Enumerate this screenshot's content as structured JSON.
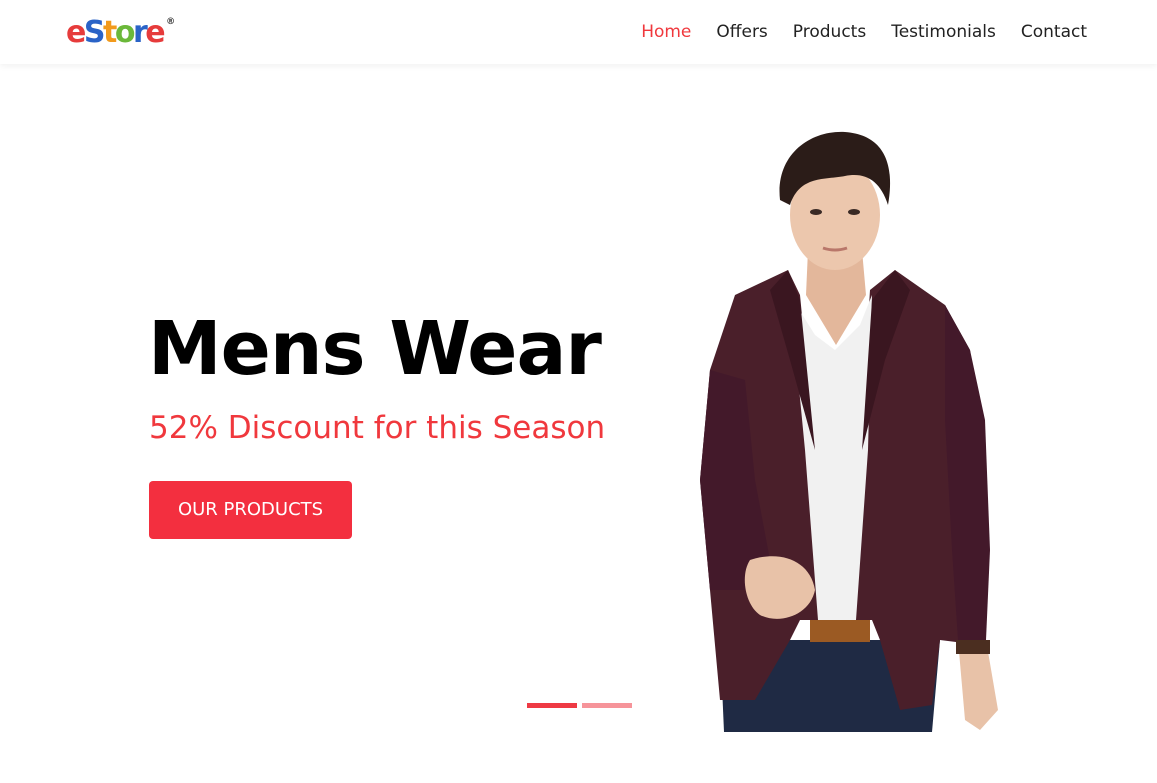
{
  "brand": {
    "letters": [
      {
        "char": "e",
        "color": "#e63b3b"
      },
      {
        "char": "S",
        "color": "#2a63c7"
      },
      {
        "char": "t",
        "color": "#f29a1c"
      },
      {
        "char": "o",
        "color": "#6bb83a"
      },
      {
        "char": "r",
        "color": "#2a63c7"
      },
      {
        "char": "e",
        "color": "#e63b3b"
      }
    ],
    "registered_mark": "®"
  },
  "nav": {
    "items": [
      {
        "label": "Home",
        "active": true
      },
      {
        "label": "Offers",
        "active": false
      },
      {
        "label": "Products",
        "active": false
      },
      {
        "label": "Testimonials",
        "active": false
      },
      {
        "label": "Contact",
        "active": false
      }
    ]
  },
  "hero": {
    "title": "Mens Wear",
    "subtitle": "52% Discount for this Season",
    "cta_label": "OUR PRODUCTS",
    "image_icon": "model-in-blazer-photo"
  },
  "carousel": {
    "slides_total": 2,
    "active_slide": 1
  },
  "colors": {
    "accent": "#f0383d",
    "button": "#f32f3f",
    "indicator_active": "#ee3a44",
    "indicator_inactive": "#f6949a",
    "blazer": "#4a1f2a",
    "shirt": "#f1f1f1"
  }
}
